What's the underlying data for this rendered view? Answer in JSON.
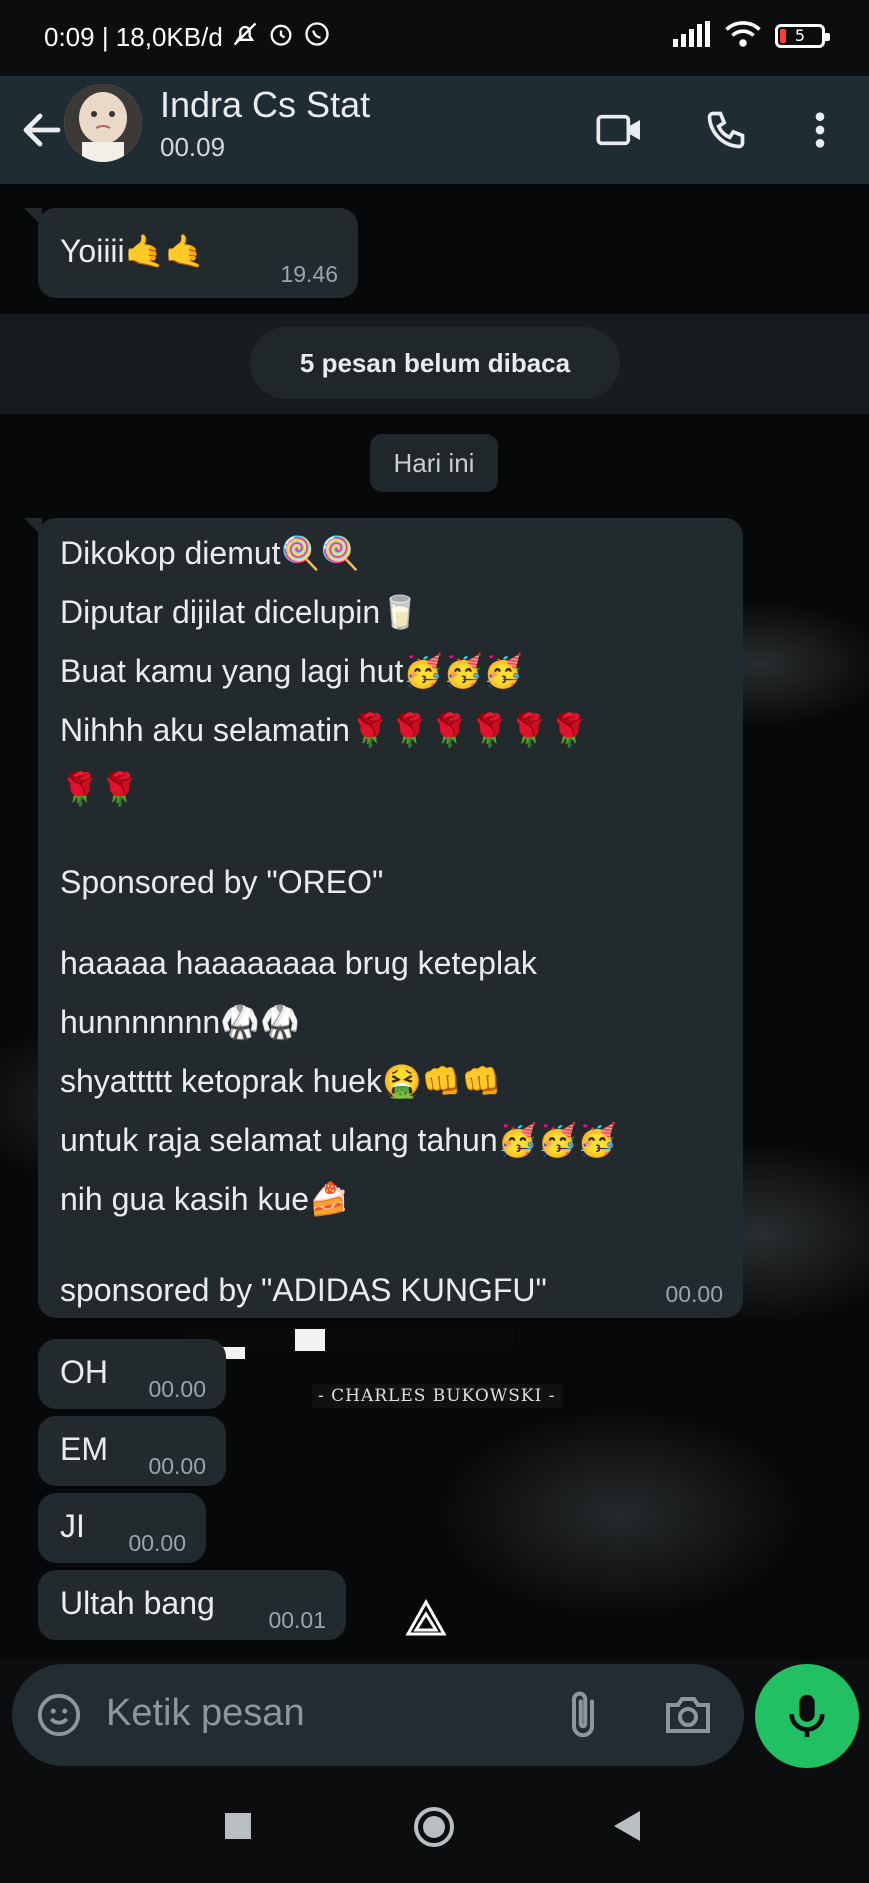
{
  "status_bar": {
    "time_info": "0:09 | 18,0KB/d",
    "battery": "5"
  },
  "header": {
    "contact_name": "Indra Cs Stat",
    "contact_status": "00.09"
  },
  "chat": {
    "prev_message": {
      "text": "Yoiiii🤙🤙",
      "time": "19.46"
    },
    "unread_notice": "5 pesan belum dibaca",
    "date_label": "Hari ini",
    "long_message": {
      "lines": [
        "Dikokop diemut🍭🍭",
        "Diputar dijilat dicelupin🥛",
        "Buat kamu yang lagi hut🥳🥳🥳",
        "Nihhh aku selamatin🌹🌹🌹🌹🌹🌹",
        "🌹🌹",
        "",
        "Sponsored by \"OREO\"",
        "",
        "haaaaa haaaaaaaa brug keteplak",
        "hunnnnnnn🥋🥋",
        "shyattttt ketoprak huek🤮👊👊",
        "untuk raja selamat ulang tahun🥳🥳🥳",
        "nih gua kasih kue🍰",
        "",
        "sponsored by \"ADIDAS KUNGFU\""
      ],
      "time": "00.00"
    },
    "short_messages": [
      {
        "text": "OH",
        "time": "00.00"
      },
      {
        "text": "EM",
        "time": "00.00"
      },
      {
        "text": "JI",
        "time": "00.00"
      },
      {
        "text": "Ultah bang",
        "time": "00.01"
      }
    ],
    "background_credit": "- CHARLES BUKOWSKI -"
  },
  "input": {
    "placeholder": "Ketik pesan"
  },
  "colors": {
    "header_bg": "#1f2c33",
    "bubble_bg": "#232a2e",
    "accent_green": "#21c063"
  },
  "icons": [
    "back-arrow-icon",
    "video-call-icon",
    "voice-call-icon",
    "more-options-icon",
    "emoji-icon",
    "attach-icon",
    "camera-icon",
    "mic-icon",
    "nav-square-icon",
    "nav-home-icon",
    "nav-back-icon"
  ]
}
